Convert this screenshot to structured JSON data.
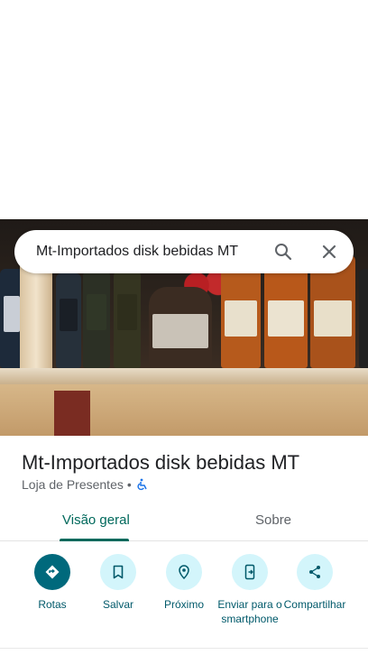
{
  "search": {
    "query": "Mt-Importados disk bebidas MT"
  },
  "place": {
    "name": "Mt-Importados disk bebidas MT",
    "category": "Loja de Presentes",
    "separator": "•"
  },
  "tabs": [
    {
      "label": "Visão geral",
      "selected": true
    },
    {
      "label": "Sobre",
      "selected": false
    }
  ],
  "actions": [
    {
      "label": "Rotas",
      "icon": "directions-icon"
    },
    {
      "label": "Salvar",
      "icon": "bookmark-icon"
    },
    {
      "label": "Próximo",
      "icon": "nearby-icon"
    },
    {
      "label": "Enviar para o smartphone",
      "icon": "send-to-phone-icon"
    },
    {
      "label": "Compartilhar",
      "icon": "share-icon"
    }
  ],
  "colors": {
    "accent": "#00695c",
    "action_primary": "#00697c",
    "action_bg": "#d3f5fb"
  }
}
